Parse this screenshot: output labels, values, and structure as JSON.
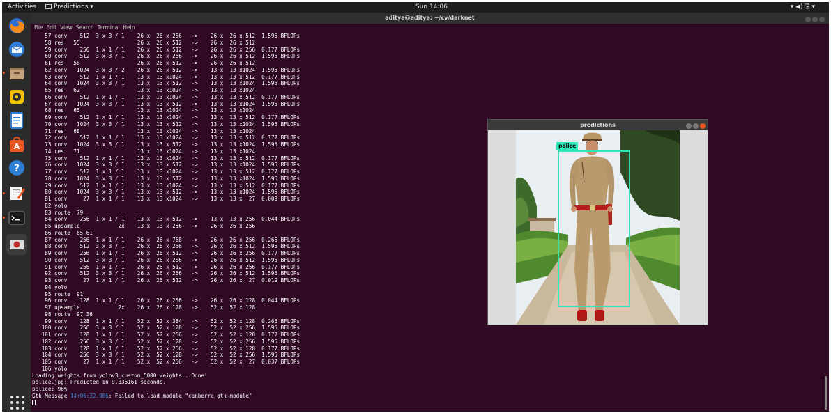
{
  "topbar": {
    "activities": "Activities",
    "app_menu": "Predictions ▾",
    "clock": "Sun 14:06",
    "tray": "▾ ◀) ⎘ ▾"
  },
  "dock": {
    "items": [
      {
        "name": "firefox-icon",
        "color": "#e8791a"
      },
      {
        "name": "thunderbird-icon",
        "color": "#2e7bd6"
      },
      {
        "name": "files-icon",
        "color": "#b08f6a"
      },
      {
        "name": "rhythmbox-icon",
        "color": "#f2c200"
      },
      {
        "name": "libreoffice-writer-icon",
        "color": "#2a7fd0"
      },
      {
        "name": "software-center-icon",
        "color": "#e95420"
      },
      {
        "name": "help-icon",
        "color": "#2d7dd2"
      },
      {
        "name": "text-editor-icon",
        "color": "#e8e8e8"
      },
      {
        "name": "terminal-icon",
        "color": "#1b1b1b"
      },
      {
        "name": "predictions-window-icon",
        "color": "#c03030"
      }
    ]
  },
  "terminal": {
    "title": "aditya@aditya: ~/cv/darknet",
    "menu": [
      "File",
      "Edit",
      "View",
      "Search",
      "Terminal",
      "Help"
    ],
    "lines": [
      "    57 conv    512  3 x 3 / 1    26 x  26 x 256   ->    26 x  26 x 512  1.595 BFLOPs",
      "    58 res   55                  26 x  26 x 512   ->    26 x  26 x 512",
      "    59 conv    256  1 x 1 / 1    26 x  26 x 512   ->    26 x  26 x 256  0.177 BFLOPs",
      "    60 conv    512  3 x 3 / 1    26 x  26 x 256   ->    26 x  26 x 512  1.595 BFLOPs",
      "    61 res   58                  26 x  26 x 512   ->    26 x  26 x 512",
      "    62 conv   1024  3 x 3 / 2    26 x  26 x 512   ->    13 x  13 x1024  1.595 BFLOPs",
      "    63 conv    512  1 x 1 / 1    13 x  13 x1024   ->    13 x  13 x 512  0.177 BFLOPs",
      "    64 conv   1024  3 x 3 / 1    13 x  13 x 512   ->    13 x  13 x1024  1.595 BFLOPs",
      "    65 res   62                  13 x  13 x1024   ->    13 x  13 x1024",
      "    66 conv    512  1 x 1 / 1    13 x  13 x1024   ->    13 x  13 x 512  0.177 BFLOPs",
      "    67 conv   1024  3 x 3 / 1    13 x  13 x 512   ->    13 x  13 x1024  1.595 BFLOPs",
      "    68 res   65                  13 x  13 x1024   ->    13 x  13 x1024",
      "    69 conv    512  1 x 1 / 1    13 x  13 x1024   ->    13 x  13 x 512  0.177 BFLOPs",
      "    70 conv   1024  3 x 3 / 1    13 x  13 x 512   ->    13 x  13 x1024  1.595 BFLOPs",
      "    71 res   68                  13 x  13 x1024   ->    13 x  13 x1024",
      "    72 conv    512  1 x 1 / 1    13 x  13 x1024   ->    13 x  13 x 512  0.177 BFLOPs",
      "    73 conv   1024  3 x 3 / 1    13 x  13 x 512   ->    13 x  13 x1024  1.595 BFLOPs",
      "    74 res   71                  13 x  13 x1024   ->    13 x  13 x1024",
      "    75 conv    512  1 x 1 / 1    13 x  13 x1024   ->    13 x  13 x 512  0.177 BFLOPs",
      "    76 conv   1024  3 x 3 / 1    13 x  13 x 512   ->    13 x  13 x1024  1.595 BFLOPs",
      "    77 conv    512  1 x 1 / 1    13 x  13 x1024   ->    13 x  13 x 512  0.177 BFLOPs",
      "    78 conv   1024  3 x 3 / 1    13 x  13 x 512   ->    13 x  13 x1024  1.595 BFLOPs",
      "    79 conv    512  1 x 1 / 1    13 x  13 x1024   ->    13 x  13 x 512  0.177 BFLOPs",
      "    80 conv   1024  3 x 3 / 1    13 x  13 x 512   ->    13 x  13 x1024  1.595 BFLOPs",
      "    81 conv     27  1 x 1 / 1    13 x  13 x1024   ->    13 x  13 x  27  0.009 BFLOPs",
      "    82 yolo",
      "    83 route  79",
      "    84 conv    256  1 x 1 / 1    13 x  13 x 512   ->    13 x  13 x 256  0.044 BFLOPs",
      "    85 upsample            2x    13 x  13 x 256   ->    26 x  26 x 256",
      "    86 route  85 61",
      "    87 conv    256  1 x 1 / 1    26 x  26 x 768   ->    26 x  26 x 256  0.266 BFLOPs",
      "    88 conv    512  3 x 3 / 1    26 x  26 x 256   ->    26 x  26 x 512  1.595 BFLOPs",
      "    89 conv    256  1 x 1 / 1    26 x  26 x 512   ->    26 x  26 x 256  0.177 BFLOPs",
      "    90 conv    512  3 x 3 / 1    26 x  26 x 256   ->    26 x  26 x 512  1.595 BFLOPs",
      "    91 conv    256  1 x 1 / 1    26 x  26 x 512   ->    26 x  26 x 256  0.177 BFLOPs",
      "    92 conv    512  3 x 3 / 1    26 x  26 x 256   ->    26 x  26 x 512  1.595 BFLOPs",
      "    93 conv     27  1 x 1 / 1    26 x  26 x 512   ->    26 x  26 x  27  0.019 BFLOPs",
      "    94 yolo",
      "    95 route  91",
      "    96 conv    128  1 x 1 / 1    26 x  26 x 256   ->    26 x  26 x 128  0.044 BFLOPs",
      "    97 upsample            2x    26 x  26 x 128   ->    52 x  52 x 128",
      "    98 route  97 36",
      "    99 conv    128  1 x 1 / 1    52 x  52 x 384   ->    52 x  52 x 128  0.266 BFLOPs",
      "   100 conv    256  3 x 3 / 1    52 x  52 x 128   ->    52 x  52 x 256  1.595 BFLOPs",
      "   101 conv    128  1 x 1 / 1    52 x  52 x 256   ->    52 x  52 x 128  0.177 BFLOPs",
      "   102 conv    256  3 x 3 / 1    52 x  52 x 128   ->    52 x  52 x 256  1.595 BFLOPs",
      "   103 conv    128  1 x 1 / 1    52 x  52 x 256   ->    52 x  52 x 128  0.177 BFLOPs",
      "   104 conv    256  3 x 3 / 1    52 x  52 x 128   ->    52 x  52 x 256  1.595 BFLOPs",
      "   105 conv     27  1 x 1 / 1    52 x  52 x 256   ->    52 x  52 x  27  0.037 BFLOPs",
      "   106 yolo",
      "Loading weights from yolov3_custom_5000.weights...Done!",
      "police.jpg: Predicted in 9.835161 seconds.",
      "police: 96%"
    ],
    "gtk_message": {
      "prefix": "Gtk-",
      "keyword": "Message",
      "time": "14:06:32.986",
      "text": ": Failed to load module \"canberra-gtk-module\""
    }
  },
  "predictions": {
    "title": "predictions",
    "label": "police"
  },
  "colors": {
    "terminal_bg": "#300a24",
    "accent": "#e95420",
    "detection_box": "#2ee6b8"
  }
}
